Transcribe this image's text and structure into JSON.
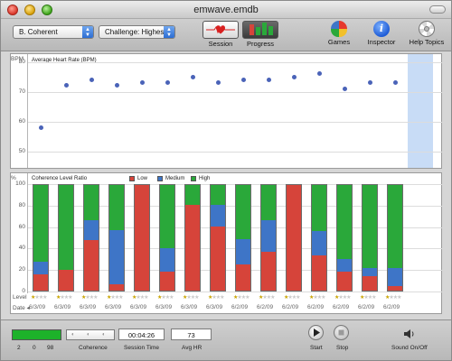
{
  "window": {
    "title": "emwave.emdb"
  },
  "toolbar": {
    "user_select": "B. Coherent",
    "challenge_select": "Challenge: Highest",
    "session_label": "Session",
    "progress_label": "Progress",
    "games_label": "Games",
    "inspector_label": "Inspector",
    "help_label": "Help Topics"
  },
  "hr_chart": {
    "title": "Average Heart Rate (BPM)",
    "unit": "BPM",
    "y_ticks": [
      "80",
      "70",
      "60",
      "50"
    ]
  },
  "coh_chart": {
    "title": "Coherence Level Ratio",
    "unit": "%",
    "y_ticks": [
      "100",
      "80",
      "60",
      "40",
      "20",
      "0"
    ],
    "legend": [
      "Low",
      "Medium",
      "High"
    ]
  },
  "rows": {
    "level_label": "Level",
    "date_label": "Date ◂"
  },
  "chart_data": [
    {
      "type": "scatter",
      "title": "Average Heart Rate (BPM)",
      "ylabel": "BPM",
      "ylim": [
        45,
        82
      ],
      "x": [
        1,
        2,
        3,
        4,
        5,
        6,
        7,
        8,
        9,
        10,
        11,
        12,
        13,
        14,
        15
      ],
      "values": [
        58,
        72,
        74,
        72,
        73,
        73,
        75,
        73,
        74,
        74,
        75,
        76,
        71,
        73,
        73
      ],
      "selected_index": 14
    },
    {
      "type": "bar",
      "title": "Coherence Level Ratio",
      "ylabel": "%",
      "ylim": [
        0,
        100
      ],
      "categories": [
        "6/3/09",
        "6/3/09",
        "6/3/09",
        "6/3/09",
        "6/3/09",
        "6/3/09",
        "6/3/09",
        "6/3/09",
        "6/2/09",
        "6/2/09",
        "6/2/09",
        "6/2/09",
        "6/2/09",
        "6/2/09",
        "6/2/09"
      ],
      "series": [
        {
          "name": "Low",
          "values": [
            15,
            20,
            48,
            6,
            100,
            18,
            81,
            61,
            25,
            37,
            100,
            33,
            18,
            14,
            4
          ]
        },
        {
          "name": "Medium",
          "values": [
            12,
            0,
            19,
            51,
            0,
            22,
            0,
            20,
            24,
            30,
            0,
            23,
            12,
            7,
            17
          ]
        },
        {
          "name": "High",
          "values": [
            73,
            80,
            33,
            43,
            0,
            60,
            19,
            19,
            51,
            33,
            0,
            44,
            70,
            79,
            79
          ]
        }
      ],
      "levels": [
        1,
        1,
        1,
        1,
        1,
        1,
        1,
        1,
        1,
        1,
        1,
        1,
        1,
        1,
        1
      ]
    }
  ],
  "legend_colors": {
    "low": "#d6443a",
    "medium": "#3e75c7",
    "high": "#2aa83a"
  },
  "bottom": {
    "meter_values": [
      "2",
      "0",
      "98"
    ],
    "coherence_label": "Coherence",
    "session_time": "00:04:26",
    "session_time_label": "Session Time",
    "avg_hr": "73",
    "avg_hr_label": "Avg HR",
    "start_label": "Start",
    "stop_label": "Stop",
    "sound_label": "Sound On/Off"
  }
}
